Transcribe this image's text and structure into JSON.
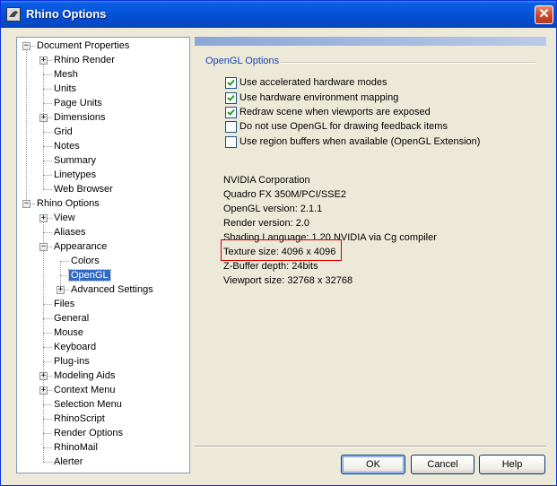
{
  "window": {
    "title": "Rhino Options",
    "close_glyph": "✕",
    "icon": "rhino-app-icon"
  },
  "tree": [
    {
      "label": "Document Properties",
      "level": 0,
      "expander": "minus"
    },
    {
      "label": "Rhino Render",
      "level": 1,
      "expander": "plus"
    },
    {
      "label": "Mesh",
      "level": 1,
      "expander": "none"
    },
    {
      "label": "Units",
      "level": 1,
      "expander": "none"
    },
    {
      "label": "Page Units",
      "level": 1,
      "expander": "none"
    },
    {
      "label": "Dimensions",
      "level": 1,
      "expander": "plus"
    },
    {
      "label": "Grid",
      "level": 1,
      "expander": "none"
    },
    {
      "label": "Notes",
      "level": 1,
      "expander": "none"
    },
    {
      "label": "Summary",
      "level": 1,
      "expander": "none"
    },
    {
      "label": "Linetypes",
      "level": 1,
      "expander": "none"
    },
    {
      "label": "Web Browser",
      "level": 1,
      "expander": "none"
    },
    {
      "label": "Rhino Options",
      "level": 0,
      "expander": "minus"
    },
    {
      "label": "View",
      "level": 1,
      "expander": "plus"
    },
    {
      "label": "Aliases",
      "level": 1,
      "expander": "none"
    },
    {
      "label": "Appearance",
      "level": 1,
      "expander": "minus"
    },
    {
      "label": "Colors",
      "level": 2,
      "expander": "none"
    },
    {
      "label": "OpenGL",
      "level": 2,
      "expander": "none",
      "selected": true
    },
    {
      "label": "Advanced Settings",
      "level": 2,
      "expander": "plus"
    },
    {
      "label": "Files",
      "level": 1,
      "expander": "none"
    },
    {
      "label": "General",
      "level": 1,
      "expander": "none"
    },
    {
      "label": "Mouse",
      "level": 1,
      "expander": "none"
    },
    {
      "label": "Keyboard",
      "level": 1,
      "expander": "none"
    },
    {
      "label": "Plug-ins",
      "level": 1,
      "expander": "none"
    },
    {
      "label": "Modeling Aids",
      "level": 1,
      "expander": "plus"
    },
    {
      "label": "Context Menu",
      "level": 1,
      "expander": "plus"
    },
    {
      "label": "Selection Menu",
      "level": 1,
      "expander": "none"
    },
    {
      "label": "RhinoScript",
      "level": 1,
      "expander": "none"
    },
    {
      "label": "Render Options",
      "level": 1,
      "expander": "none"
    },
    {
      "label": "RhinoMail",
      "level": 1,
      "expander": "none"
    },
    {
      "label": "Alerter",
      "level": 1,
      "expander": "none"
    }
  ],
  "opengl": {
    "section_title": "OpenGL Options",
    "options": [
      {
        "label": "Use accelerated hardware modes",
        "checked": true
      },
      {
        "label": "Use hardware environment mapping",
        "checked": true
      },
      {
        "label": "Redraw scene when viewports are exposed",
        "checked": true
      },
      {
        "label": "Do not use OpenGL for drawing feedback items",
        "checked": false
      },
      {
        "label": "Use region buffers when available (OpenGL Extension)",
        "checked": false
      }
    ],
    "info": [
      "NVIDIA Corporation",
      "Quadro FX 350M/PCI/SSE2",
      "OpenGL version: 2.1.1",
      "Render version: 2.0",
      "Shading Language: 1.20 NVIDIA via Cg compiler",
      "Texture size: 4096 x 4096",
      "Z-Buffer depth: 24bits",
      "Viewport size: 32768 x 32768"
    ]
  },
  "buttons": {
    "ok": "OK",
    "cancel": "Cancel",
    "help": "Help"
  },
  "colors": {
    "title_bar": "#0553d8",
    "selection": "#316ac5",
    "section_title": "#1545b8",
    "highlight_box": "#d40000",
    "dialog_bg": "#ece9d8"
  }
}
